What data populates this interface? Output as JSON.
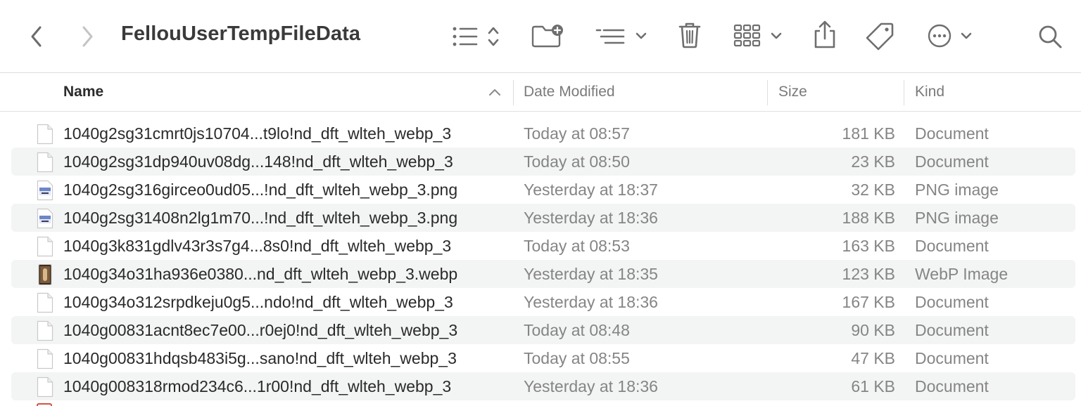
{
  "window": {
    "title": "FellouUserTempFileData"
  },
  "toolbar": {
    "back_icon": "chevron-left-icon",
    "forward_icon": "chevron-right-icon",
    "view_icon": "list-view-icon",
    "new_folder_icon": "new-folder-icon",
    "group_icon": "group-by-icon",
    "trash_icon": "trash-icon",
    "gallery_icon": "icon-grid-icon",
    "share_icon": "share-icon",
    "tag_icon": "tag-icon",
    "more_icon": "ellipsis-circle-icon",
    "search_icon": "search-icon"
  },
  "columns": {
    "name": "Name",
    "date": "Date Modified",
    "size": "Size",
    "kind": "Kind",
    "sort": "ascending"
  },
  "files": [
    {
      "name": "1040g2sg31cmrt0js10704...t9lo!nd_dft_wlteh_webp_3",
      "date": "Today at 08:57",
      "size": "181 KB",
      "kind": "Document",
      "icon": "document-icon"
    },
    {
      "name": "1040g2sg31dp940uv08dg...148!nd_dft_wlteh_webp_3",
      "date": "Today at 08:50",
      "size": "23 KB",
      "kind": "Document",
      "icon": "document-icon"
    },
    {
      "name": "1040g2sg316girceo0ud05...!nd_dft_wlteh_webp_3.png",
      "date": "Yesterday at 18:37",
      "size": "32 KB",
      "kind": "PNG image",
      "icon": "png-image-icon"
    },
    {
      "name": "1040g2sg31408n2lg1m70...!nd_dft_wlteh_webp_3.png",
      "date": "Yesterday at 18:36",
      "size": "188 KB",
      "kind": "PNG image",
      "icon": "png-image-icon"
    },
    {
      "name": "1040g3k831gdlv43r3s7g4...8s0!nd_dft_wlteh_webp_3",
      "date": "Today at 08:53",
      "size": "163 KB",
      "kind": "Document",
      "icon": "document-icon"
    },
    {
      "name": "1040g34o31ha936e0380...nd_dft_wlteh_webp_3.webp",
      "date": "Yesterday at 18:35",
      "size": "123 KB",
      "kind": "WebP Image",
      "icon": "webp-thumbnail-icon"
    },
    {
      "name": "1040g34o312srpdkeju0g5...ndo!nd_dft_wlteh_webp_3",
      "date": "Yesterday at 18:36",
      "size": "167 KB",
      "kind": "Document",
      "icon": "document-icon"
    },
    {
      "name": "1040g00831acnt8ec7e00...r0ej0!nd_dft_wlteh_webp_3",
      "date": "Today at 08:48",
      "size": "90 KB",
      "kind": "Document",
      "icon": "document-icon"
    },
    {
      "name": "1040g00831hdqsb483i5g...sano!nd_dft_wlteh_webp_3",
      "date": "Today at 08:55",
      "size": "47 KB",
      "kind": "Document",
      "icon": "document-icon"
    },
    {
      "name": "1040g008318rmod234c6...1r00!nd_dft_wlteh_webp_3",
      "date": "Yesterday at 18:36",
      "size": "61 KB",
      "kind": "Document",
      "icon": "document-icon"
    }
  ],
  "colors": {
    "row_alt": "#f3f4f4",
    "text_primary": "#2a2a2a",
    "text_secondary": "#858585",
    "icon": "#6e6e6e"
  }
}
